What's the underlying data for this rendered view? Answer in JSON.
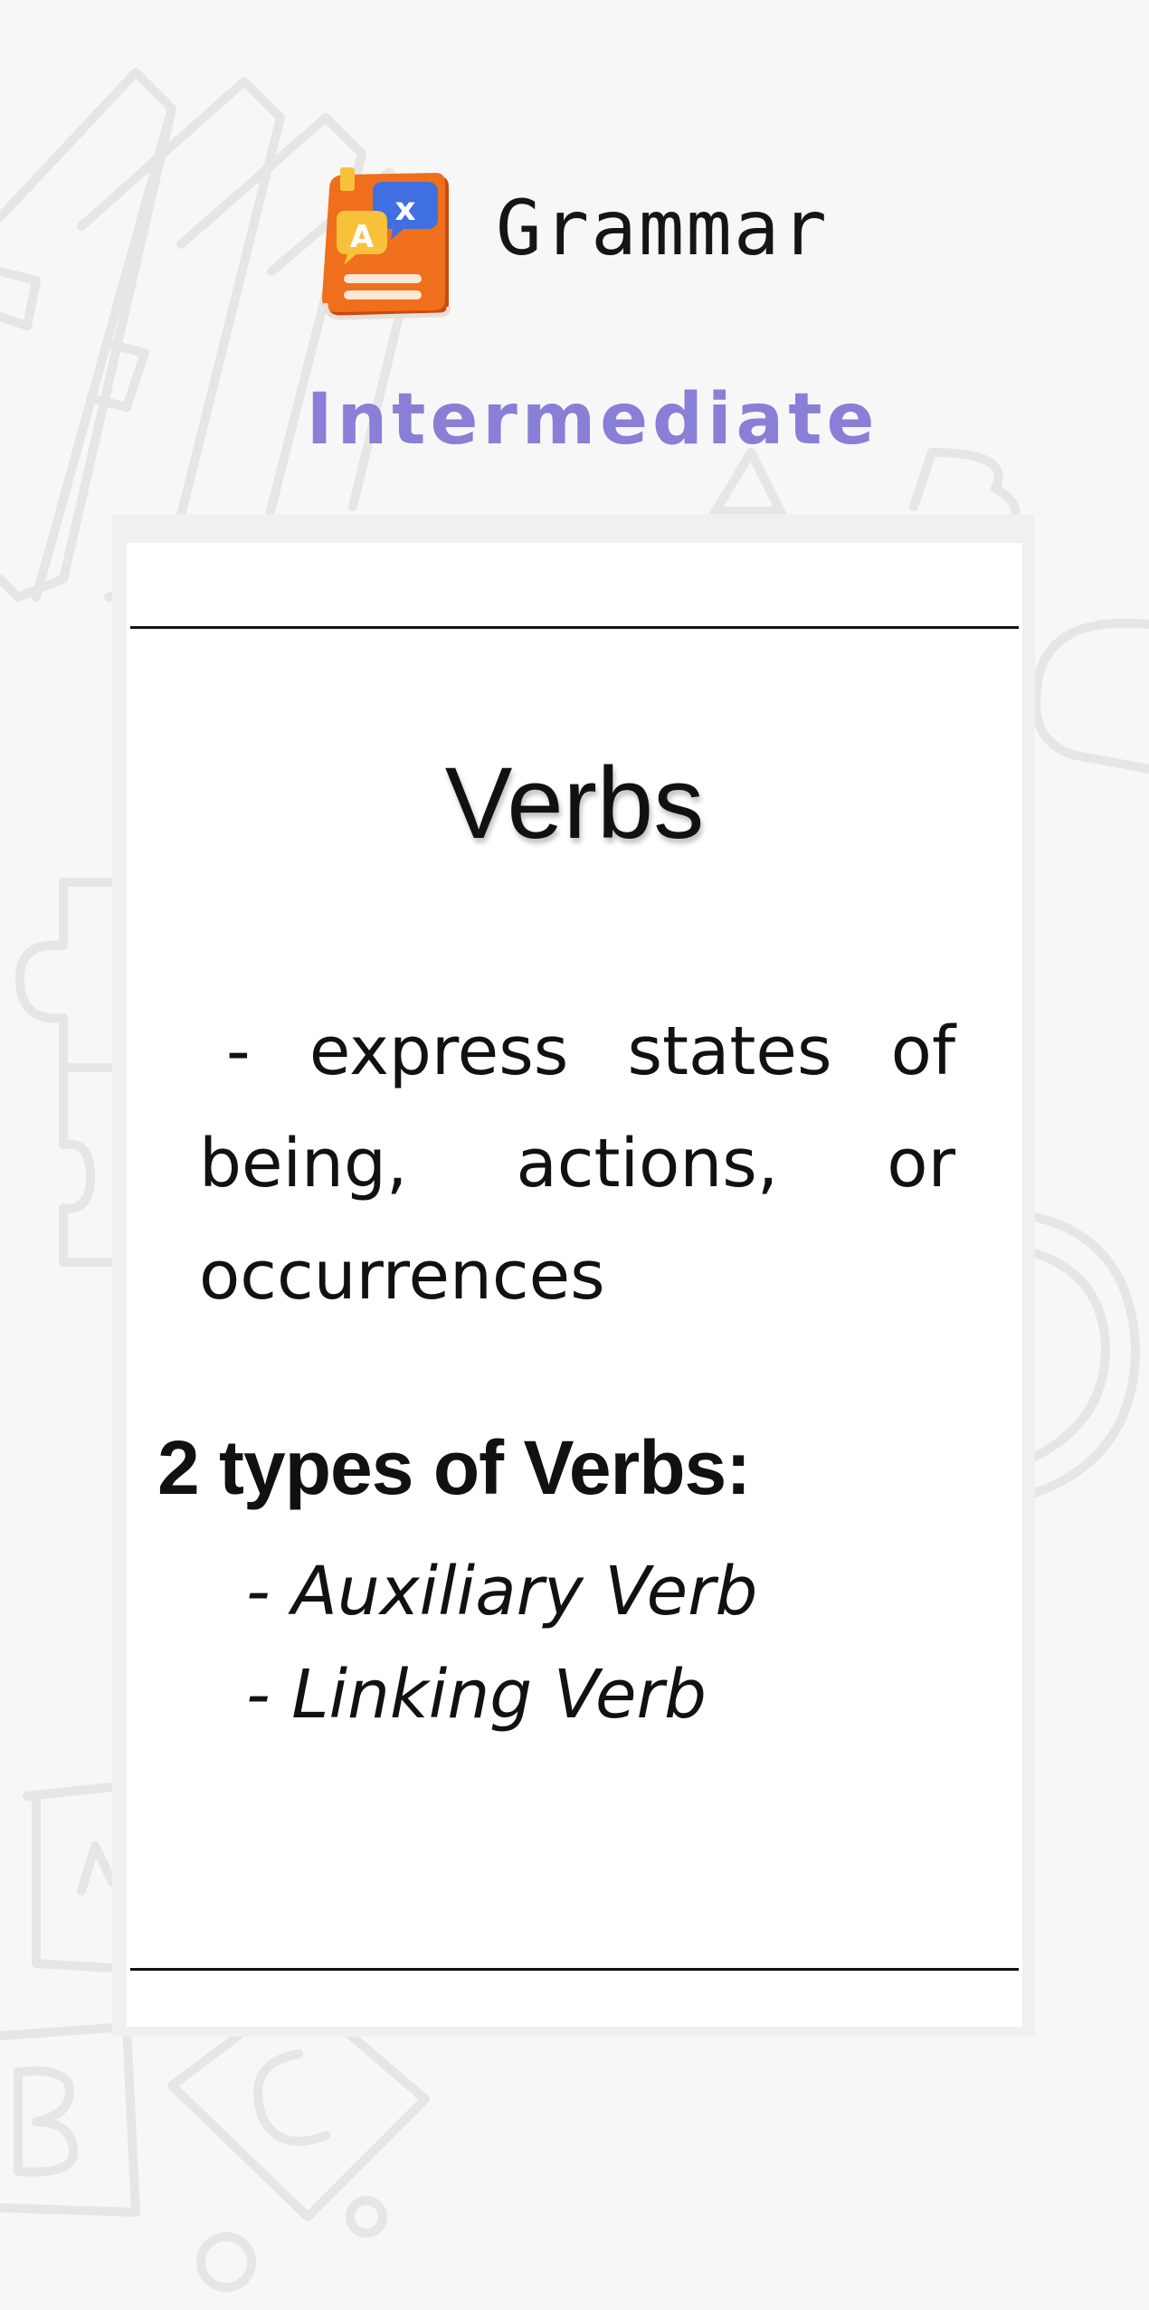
{
  "header": {
    "app_icon": "grammar-book-translate-icon",
    "title": "Grammar",
    "level": "Intermediate"
  },
  "card": {
    "topic": "Verbs",
    "definition": "- express states of being, actions, or occurrences",
    "types_heading": "2 types of Verbs:",
    "types": [
      "- Auxiliary Verb",
      "- Linking Verb"
    ]
  },
  "colors": {
    "background": "#f7f7f7",
    "level_text": "#8a7fd6",
    "card": "#ffffff",
    "icon_book": "#ef6f1c",
    "icon_bubble_blue": "#3f6fe0",
    "icon_bubble_yellow": "#f7c23a"
  }
}
